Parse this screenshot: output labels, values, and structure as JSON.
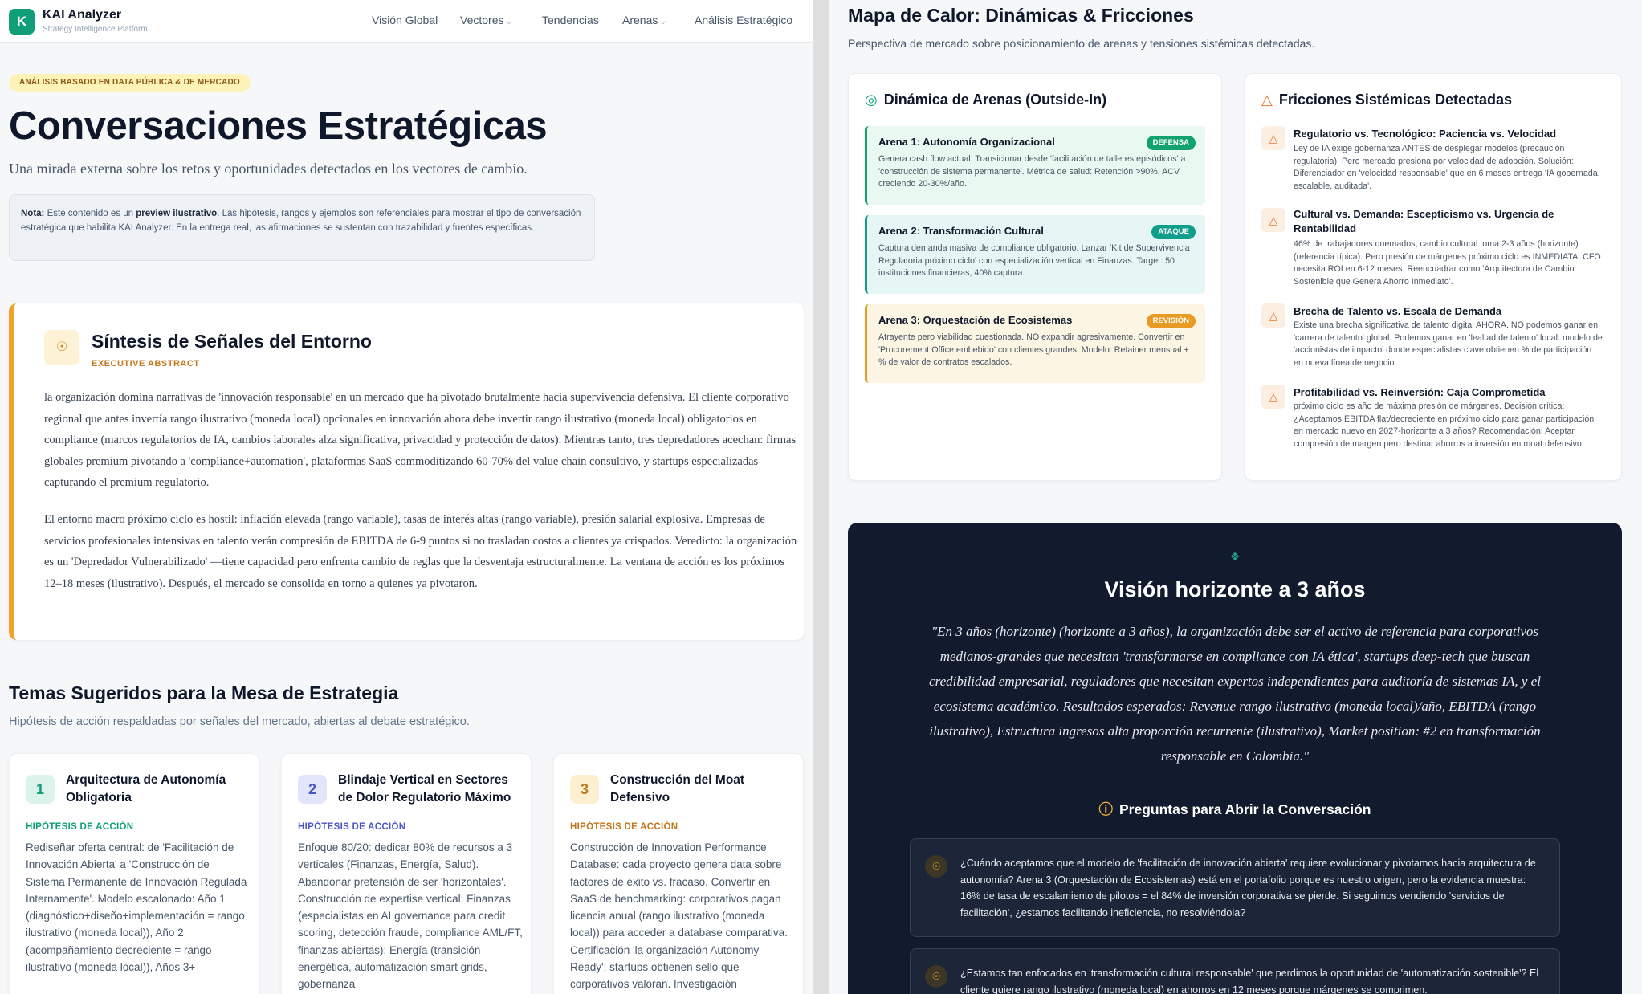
{
  "nav": {
    "logo_letter": "K",
    "brand": "KAI Analyzer",
    "brand_sub": "Strategy Intelligence Platform",
    "items": [
      "Visión Global",
      "Vectores",
      "Tendencias",
      "Arenas",
      "Análisis Estratégico"
    ]
  },
  "hero": {
    "pill": "ANÁLISIS BASADO EN DATA PÚBLICA & DE MERCADO",
    "title": "Conversaciones Estratégicas",
    "subtitle": "Una mirada externa sobre los retos y oportunidades detectados en los vectores de cambio.",
    "note_label": "Nota:",
    "note_text": " Este contenido es un ",
    "note_bold2": "preview ilustrativo",
    "note_text2": ". Las hipótesis, rangos y ejemplos son referenciales para mostrar el tipo de conversación estratégica que habilita KAI Analyzer. En la entrega real, las afirmaciones se sustentan con trazabilidad y fuentes específicas."
  },
  "exec": {
    "title": "Síntesis de Señales del Entorno",
    "subtitle": "EXECUTIVE ABSTRACT",
    "p1": "la organización domina narrativas de 'innovación responsable' en un mercado que ha pivotado brutalmente hacia supervivencia defensiva. El cliente corporativo regional que antes invertía rango ilustrativo (moneda local) opcionales en innovación ahora debe invertir rango ilustrativo (moneda local) obligatorios en compliance (marcos regulatorios de IA, cambios laborales alza significativa, privacidad y protección de datos). Mientras tanto, tres depredadores acechan: firmas globales premium pivotando a 'compliance+automation', plataformas SaaS commoditizando 60-70% del value chain consultivo, y startups especializadas capturando el premium regulatorio.",
    "p2": "El entorno macro próximo ciclo es hostil: inflación elevada (rango variable), tasas de interés altas (rango variable), presión salarial explosiva. Empresas de servicios profesionales intensivas en talento verán compresión de EBITDA de 6-9 puntos si no trasladan costos a clientes ya crispados. Veredicto: la organización es un 'Depredador Vulnerabilizado' —tiene capacidad pero enfrenta cambio de reglas que la desventaja estructuralmente. La ventana de acción es los próximos 12–18 meses (ilustrativo). Después, el mercado se consolida en torno a quienes ya pivotaron."
  },
  "topics": {
    "title": "Temas Sugeridos para la Mesa de Estrategia",
    "subtitle": "Hipótesis de acción respaldadas por señales del mercado, abiertas al debate estratégico.",
    "label": "HIPÓTESIS DE ACCIÓN",
    "cards": [
      {
        "num": "1",
        "title": "Arquitectura de Autonomía Obligatoria",
        "bg": "#dcf3ec",
        "fg": "#0f9e78",
        "label_color": "#0f9e78",
        "text": "Rediseñar oferta central: de 'Facilitación de Innovación Abierta' a 'Construcción de Sistema Permanente de Innovación Regulada Internamente'. Modelo escalonado: Año 1 (diagnóstico+diseño+implementación = rango ilustrativo (moneda local)), Año 2 (acompañamiento decreciente = rango ilustrativo (moneda local)), Años 3+"
      },
      {
        "num": "2",
        "title": "Blindaje Vertical en Sectores de Dolor Regulatorio Máximo",
        "bg": "#e3e6fb",
        "fg": "#4a55c9",
        "label_color": "#4a55c9",
        "text": "Enfoque 80/20: dedicar 80% de recursos a 3 verticales (Finanzas, Energía, Salud). Abandonar pretensión de ser 'horizontales'. Construcción de expertise vertical: Finanzas (especialistas en AI governance para credit scoring, detección fraude, compliance AML/FT, finanzas abiertas); Energía (transición energética, automatización smart grids, gobernanza"
      },
      {
        "num": "3",
        "title": "Construcción del Moat Defensivo",
        "bg": "#fdf0d0",
        "fg": "#b7791f",
        "label_color": "#c2761a",
        "text": "Construcción de Innovation Performance Database: cada proyecto genera data sobre factores de éxito vs. fracaso. Convertir en SaaS de benchmarking: corporativos pagan licencia anual (rango ilustrativo (moneda local)) para acceder a database comparativa. Certificación 'la organización Autonomy Ready': startups obtienen sello que corporativos valoran. Investigación"
      }
    ]
  },
  "heatmap": {
    "title": "Mapa de Calor: Dinámicas & Fricciones",
    "subtitle": "Perspectiva de mercado sobre posicionamiento de arenas y tensiones sistémicas detectadas.",
    "arenas_title": "Dinámica de Arenas (Outside-In)",
    "arenas": [
      {
        "name": "Arena 1: Autonomía Organizacional",
        "badge": "DEFENSA",
        "badge_color": "#12a26f",
        "bg": "#e9f8f1",
        "border": "#12a26f",
        "text": "Genera cash flow actual. Transicionar desde 'facilitación de talleres episódicos' a 'construcción de sistema permanente'. Métrica de salud: Retención >90%, ACV creciendo 20-30%/año."
      },
      {
        "name": "Arena 2: Transformación Cultural",
        "badge": "ATAQUE",
        "badge_color": "#0f9e8c",
        "bg": "#e6f6f4",
        "border": "#0f9e8c",
        "text": "Captura demanda masiva de compliance obligatorio. Lanzar 'Kit de Supervivencia Regulatoria próximo ciclo' con especialización vertical en Finanzas. Target: 50 instituciones financieras, 40% captura."
      },
      {
        "name": "Arena 3: Orquestación de Ecosistemas",
        "badge": "REVISIÓN",
        "badge_color": "#e89a22",
        "bg": "#fdf5e3",
        "border": "#e89a22",
        "text": "Atrayente pero viabilidad cuestionada. NO expandir agresivamente. Convertir en 'Procurement Office embebido' con clientes grandes. Modelo: Retainer mensual + % de valor de contratos escalados."
      }
    ],
    "frictions_title": "Fricciones Sistémicas Detectadas",
    "frictions": [
      {
        "title": "Regulatorio vs. Tecnológico: Paciencia vs. Velocidad",
        "text": "Ley de IA exige gobernanza ANTES de desplegar modelos (precaución regulatoria). Pero mercado presiona por velocidad de adopción. Solución: Diferenciador en 'velocidad responsable' que en 6 meses entrega 'IA gobernada, escalable, auditada'."
      },
      {
        "title": "Cultural vs. Demanda: Escepticismo vs. Urgencia de Rentabilidad",
        "text": "46% de trabajadores quemados; cambio cultural toma 2-3 años (horizonte) (referencia típica). Pero presión de márgenes próximo ciclo es INMEDIATA. CFO necesita ROI en 6-12 meses. Reencuadrar como 'Arquitectura de Cambio Sostenible que Genera Ahorro Inmediato'."
      },
      {
        "title": "Brecha de Talento vs. Escala de Demanda",
        "text": "Existe una brecha significativa de talento digital AHORA. NO podemos ganar en 'carrera de talento' global. Podemos ganar en 'lealtad de talento' local: modelo de 'accionistas de impacto' donde especialistas clave obtienen % de participación en nueva línea de negocio."
      },
      {
        "title": "Profitabilidad vs. Reinversión: Caja Comprometida",
        "text": "próximo ciclo es año de máxima presión de márgenes. Decisión crítica: ¿Aceptamos EBITDA flat/decreciente en próximo ciclo para ganar participación en mercado nuevo en 2027-horizonte a 3 años? Recomendación: Aceptar compresión de margen pero destinar ahorros a inversión en moat defensivo."
      }
    ]
  },
  "vision": {
    "title": "Visión horizonte a 3 años",
    "quote": "\"En 3 años (horizonte) (horizonte a 3 años), la organización debe ser el activo de referencia para corporativos medianos-grandes que necesitan 'transformarse en compliance con IA ética', startups deep-tech que buscan credibilidad empresarial, reguladores que necesitan expertos independientes para auditoría de sistemas IA, y el ecosistema académico. Resultados esperados: Revenue rango ilustrativo (moneda local)/año, EBITDA (rango ilustrativo), Estructura ingresos alta proporción recurrente (ilustrativo), Market position: #2 en transformación responsable en Colombia.\"",
    "questions_title": "Preguntas para Abrir la Conversación",
    "questions": [
      "¿Cuándo aceptamos que el modelo de 'facilitación de innovación abierta' requiere evolucionar y pivotamos hacia arquitectura de autonomía? Arena 3 (Orquestación de Ecosistemas) está en el portafolio porque es nuestro origen, pero la evidencia muestra: 16% de tasa de escalamiento de pilotos = el 84% de inversión corporativa se pierde. Si seguimos vendiendo 'servicios de facilitación', ¿estamos facilitando ineficiencia, no resolviéndola?",
      "¿Estamos tan enfocados en 'transformación cultural responsable' que perdimos la oportunidad de 'automatización sostenible'? El cliente quiere rango ilustrativo (moneda local) en ahorros en 12 meses porque márgenes se comprimen."
    ]
  }
}
